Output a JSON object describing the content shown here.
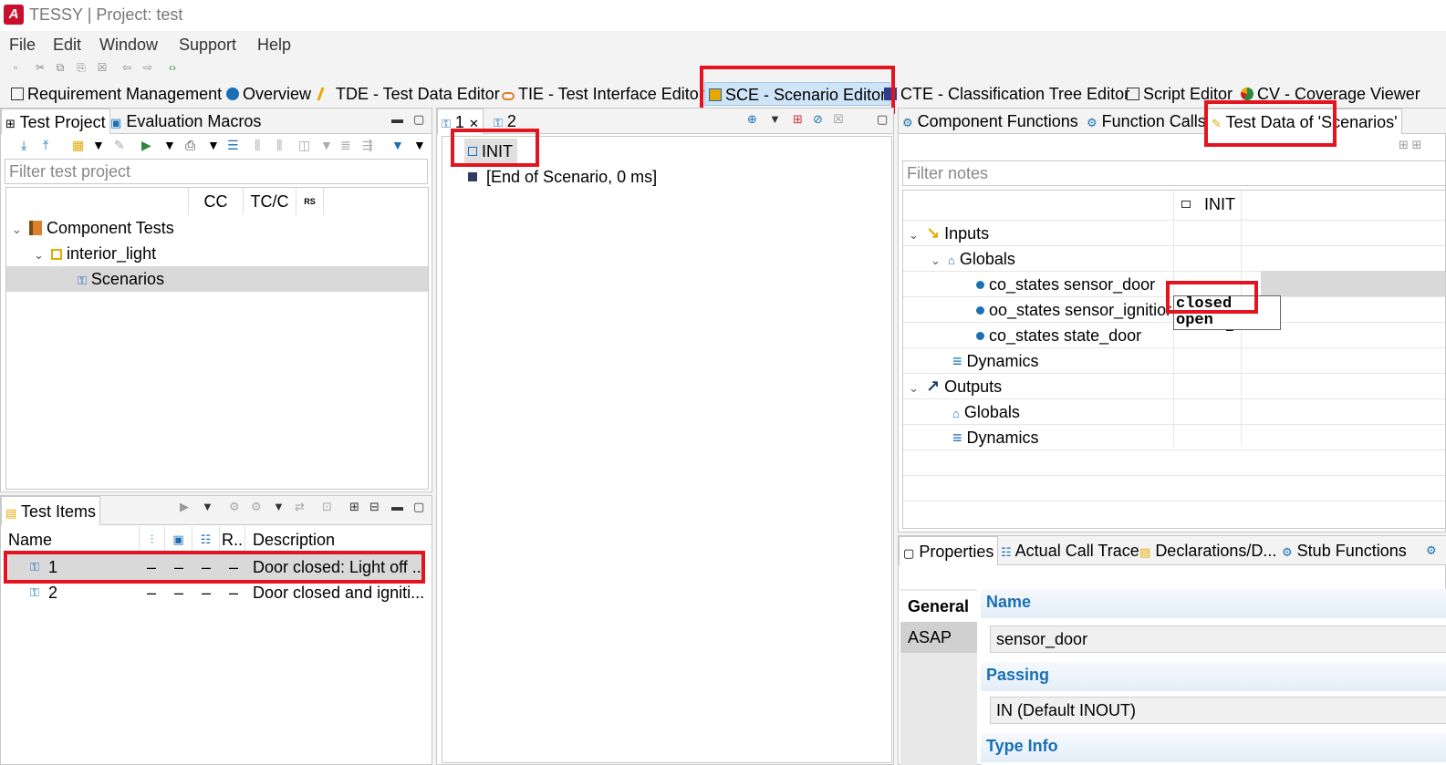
{
  "window": {
    "title": "TESSY | Project: test"
  },
  "menu": [
    "File",
    "Edit",
    "Window",
    "Support",
    "Help"
  ],
  "perspectives": [
    {
      "label": "Requirement Management"
    },
    {
      "label": "Overview"
    },
    {
      "label": "TDE - Test Data Editor"
    },
    {
      "label": "TIE - Test Interface Editor"
    },
    {
      "label": "SCE - Scenario Editor",
      "active": true
    },
    {
      "label": "CTE - Classification Tree Editor"
    },
    {
      "label": "Script Editor"
    },
    {
      "label": "CV - Coverage Viewer"
    }
  ],
  "left_top": {
    "tabs": [
      "Test Project",
      "Evaluation Macros"
    ],
    "filter_placeholder": "Filter test project",
    "columns": [
      "CC",
      "TC/C",
      "RS"
    ],
    "tree": [
      {
        "label": "Component Tests"
      },
      {
        "label": "interior_light"
      },
      {
        "label": "Scenarios"
      }
    ]
  },
  "left_bottom": {
    "tab": "Test Items",
    "columns": [
      "Name",
      "R..",
      "Description"
    ],
    "rows": [
      {
        "name": "1",
        "c1": "–",
        "c2": "–",
        "c3": "–",
        "c4": "–",
        "desc": "Door closed: Light off .."
      },
      {
        "name": "2",
        "c1": "–",
        "c2": "–",
        "c3": "–",
        "c4": "–",
        "desc": "Door closed and igniti..."
      }
    ]
  },
  "center": {
    "tabs": [
      "1",
      "2"
    ],
    "items": [
      "INIT",
      "[End of Scenario, 0 ms]"
    ]
  },
  "right_top": {
    "tabs": [
      "Component Functions",
      "Function Calls",
      "Test Data of 'Scenarios'"
    ],
    "filter_placeholder": "Filter notes",
    "column_header": "INIT",
    "tree": {
      "inputs": "Inputs",
      "globals": "Globals",
      "var1": "co_states sensor_door",
      "var2": "oo_states sensor_ignition",
      "var3": "co_states state_door",
      "dynamics": "Dynamics",
      "outputs": "Outputs",
      "out_globals": "Globals",
      "out_dynamics": "Dynamics"
    },
    "dropdown": [
      "closed",
      "open"
    ],
    "cell_dash": "–"
  },
  "right_bottom": {
    "tabs": [
      "Properties",
      "Actual Call Trace",
      "Declarations/D...",
      "Stub Functions"
    ],
    "side_tabs": [
      "General",
      "ASAP"
    ],
    "name_label": "Name",
    "name_value": "sensor_door",
    "passing_label": "Passing",
    "passing_value": "IN (Default INOUT)",
    "type_info_label": "Type Info"
  }
}
